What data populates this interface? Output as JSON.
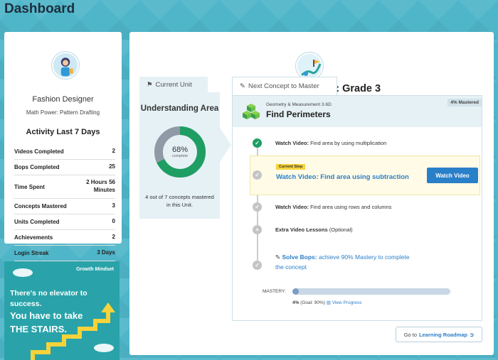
{
  "page": {
    "title": "Dashboard"
  },
  "profile": {
    "name": "Fashion Designer",
    "math_power": "Math Power: Pattern Drafting",
    "activity_title": "Activity Last 7 Days",
    "stats": [
      {
        "label": "Videos Completed",
        "value": "2"
      },
      {
        "label": "Bops Completed",
        "value": "25"
      },
      {
        "label": "Time Spent",
        "value": "2 Hours 56 Minutes"
      },
      {
        "label": "Concepts Mastered",
        "value": "3"
      },
      {
        "label": "Units Completed",
        "value": "0"
      },
      {
        "label": "Achievements",
        "value": "2"
      },
      {
        "label": "Login Streak",
        "value": "3 Days"
      }
    ]
  },
  "poster": {
    "heading": "Growth Mindset",
    "line1": "There's no elevator to success.",
    "line2": "You have to take",
    "line3": "THE STAIRS."
  },
  "roadmap": {
    "title": "Learning Roadmap: Grade 3",
    "current_unit_tab": "Current Unit",
    "unit_name": "Understanding Area",
    "unit_percent_value": 68,
    "unit_percent": "68%",
    "unit_percent_sub": "complete",
    "unit_desc": "4 out of 7 concepts mastered in this Unit.",
    "next_concept_tab": "Next Concept to Master",
    "concept_category": "Geometry & Measurement 3.6D",
    "concept_name": "Find Perimeters",
    "mastered_badge": "4% Mastered",
    "steps": [
      {
        "prefix": "Watch Video:",
        "text": " Find area by using multiplication",
        "status": "done"
      },
      {
        "prefix": "Watch Video:",
        "text": " Find area using rows and columns",
        "status": "todo"
      },
      {
        "prefix": "Extra Video Lessons",
        "text": " (Optional)",
        "status": "todo"
      }
    ],
    "current_step": {
      "tag": "Current Step",
      "title": "Watch Video: Find area using subtraction",
      "button": "Watch Video"
    },
    "bops_step": {
      "link": "Solve Bops:",
      "text": " achieve 90% Mastery to complete the concept"
    },
    "mastery": {
      "label": "MASTERY:",
      "value": 4,
      "percent": "4%",
      "goal": " (Goal: 90%)",
      "view_progress": "View Progress"
    },
    "goto_prefix": "Go to",
    "goto_link": "Learning Roadmap"
  },
  "colors": {
    "accent_blue": "#2a7fc9",
    "success_green": "#1e9e63",
    "background_teal": "#4fb6c9"
  }
}
